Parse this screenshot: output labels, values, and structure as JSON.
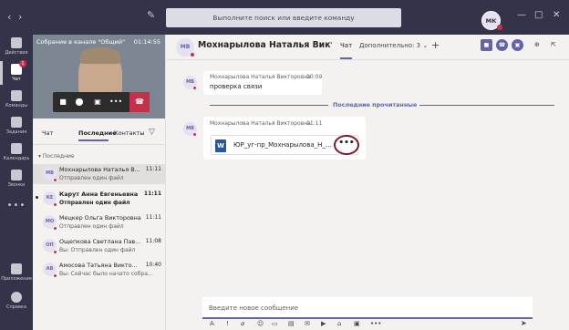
{
  "topbar": {
    "search_placeholder": "Выполните поиск или введите команду",
    "user_initials": "МК",
    "back_glyph": "‹",
    "forward_glyph": "›",
    "compose_glyph": "✎",
    "window_controls": [
      "—",
      "□",
      "✕"
    ]
  },
  "rail": {
    "items": [
      {
        "label": "Действия",
        "icon": "bell-icon"
      },
      {
        "label": "Чат",
        "icon": "chat-icon",
        "active": true,
        "badge": "1"
      },
      {
        "label": "Команды",
        "icon": "teams-icon"
      },
      {
        "label": "Задания",
        "icon": "assignments-icon"
      },
      {
        "label": "Календарь",
        "icon": "calendar-icon"
      },
      {
        "label": "Звонки",
        "icon": "phone-icon"
      }
    ],
    "more": "•••",
    "bottom_items": [
      {
        "label": "Приложения",
        "icon": "apps-icon"
      },
      {
        "label": "Справка",
        "icon": "help-icon"
      }
    ]
  },
  "call": {
    "title": "Собрание в канале \"Общий\"",
    "time": "01:14:55",
    "controls": {
      "camera": "■",
      "mic": "⬤",
      "share": "▣",
      "more": "•••",
      "hangup": "☎"
    }
  },
  "panel": {
    "tabs": [
      "Чат",
      "Последние",
      "Контакты"
    ],
    "active_tab": "Последние",
    "recent_label": "Последние",
    "chats": [
      {
        "initials": "МВ",
        "name": "Мохнарылова Наталья В...",
        "time": "11:11",
        "preview": "Отправлен один файл",
        "selected": true,
        "unread": false
      },
      {
        "initials": "КЕ",
        "name": "Карут Анна Евгеньевна",
        "time": "11:11",
        "preview": "Отправлен один файл",
        "selected": false,
        "unread": true
      },
      {
        "initials": "МО",
        "name": "Мецкер Ольга Викторовна",
        "time": "11:11",
        "preview": "Отправлен один файл",
        "selected": false,
        "unread": false
      },
      {
        "initials": "ОП",
        "name": "Ощепкова Светлана Пав...",
        "time": "11:08",
        "preview": "Вы: Отправлен один файл",
        "selected": false,
        "unread": false
      },
      {
        "initials": "АВ",
        "name": "Амосова Татьяна Викто...",
        "time": "10:40",
        "preview": "Вы: Сейчас было начато собра...",
        "selected": false,
        "unread": false
      }
    ]
  },
  "header": {
    "initials": "МВ",
    "name": "Мохнарылова Наталья Виктор...",
    "tab_chat": "Чат",
    "tab_more": "Дополнительно: 3",
    "add_glyph": "+"
  },
  "messages": [
    {
      "initials": "МВ",
      "sender": "Мохнарылова Наталья Викторовна",
      "time": "10:09",
      "text": "проверка связи"
    },
    {
      "initials": "МВ",
      "sender": "Мохнарылова Наталья Викторовна",
      "time": "11:11",
      "file_name": "ЮР_уг-пр_Мохнарылова_Н_В_...",
      "more": "•••"
    }
  ],
  "last_read_label": "Последние прочитанные",
  "compose": {
    "placeholder": "Введите новое сообщение",
    "toolbar": [
      "A",
      "!",
      "⌀",
      "☺",
      "▭",
      "▤",
      "✉",
      "▶",
      "⌂",
      "▣",
      "•••"
    ],
    "send_glyph": "➤"
  },
  "colors": {
    "accent": "#6264a7",
    "rail_bg": "#33344a",
    "presence_busy": "#c4314b",
    "hangup": "#c4314b"
  }
}
